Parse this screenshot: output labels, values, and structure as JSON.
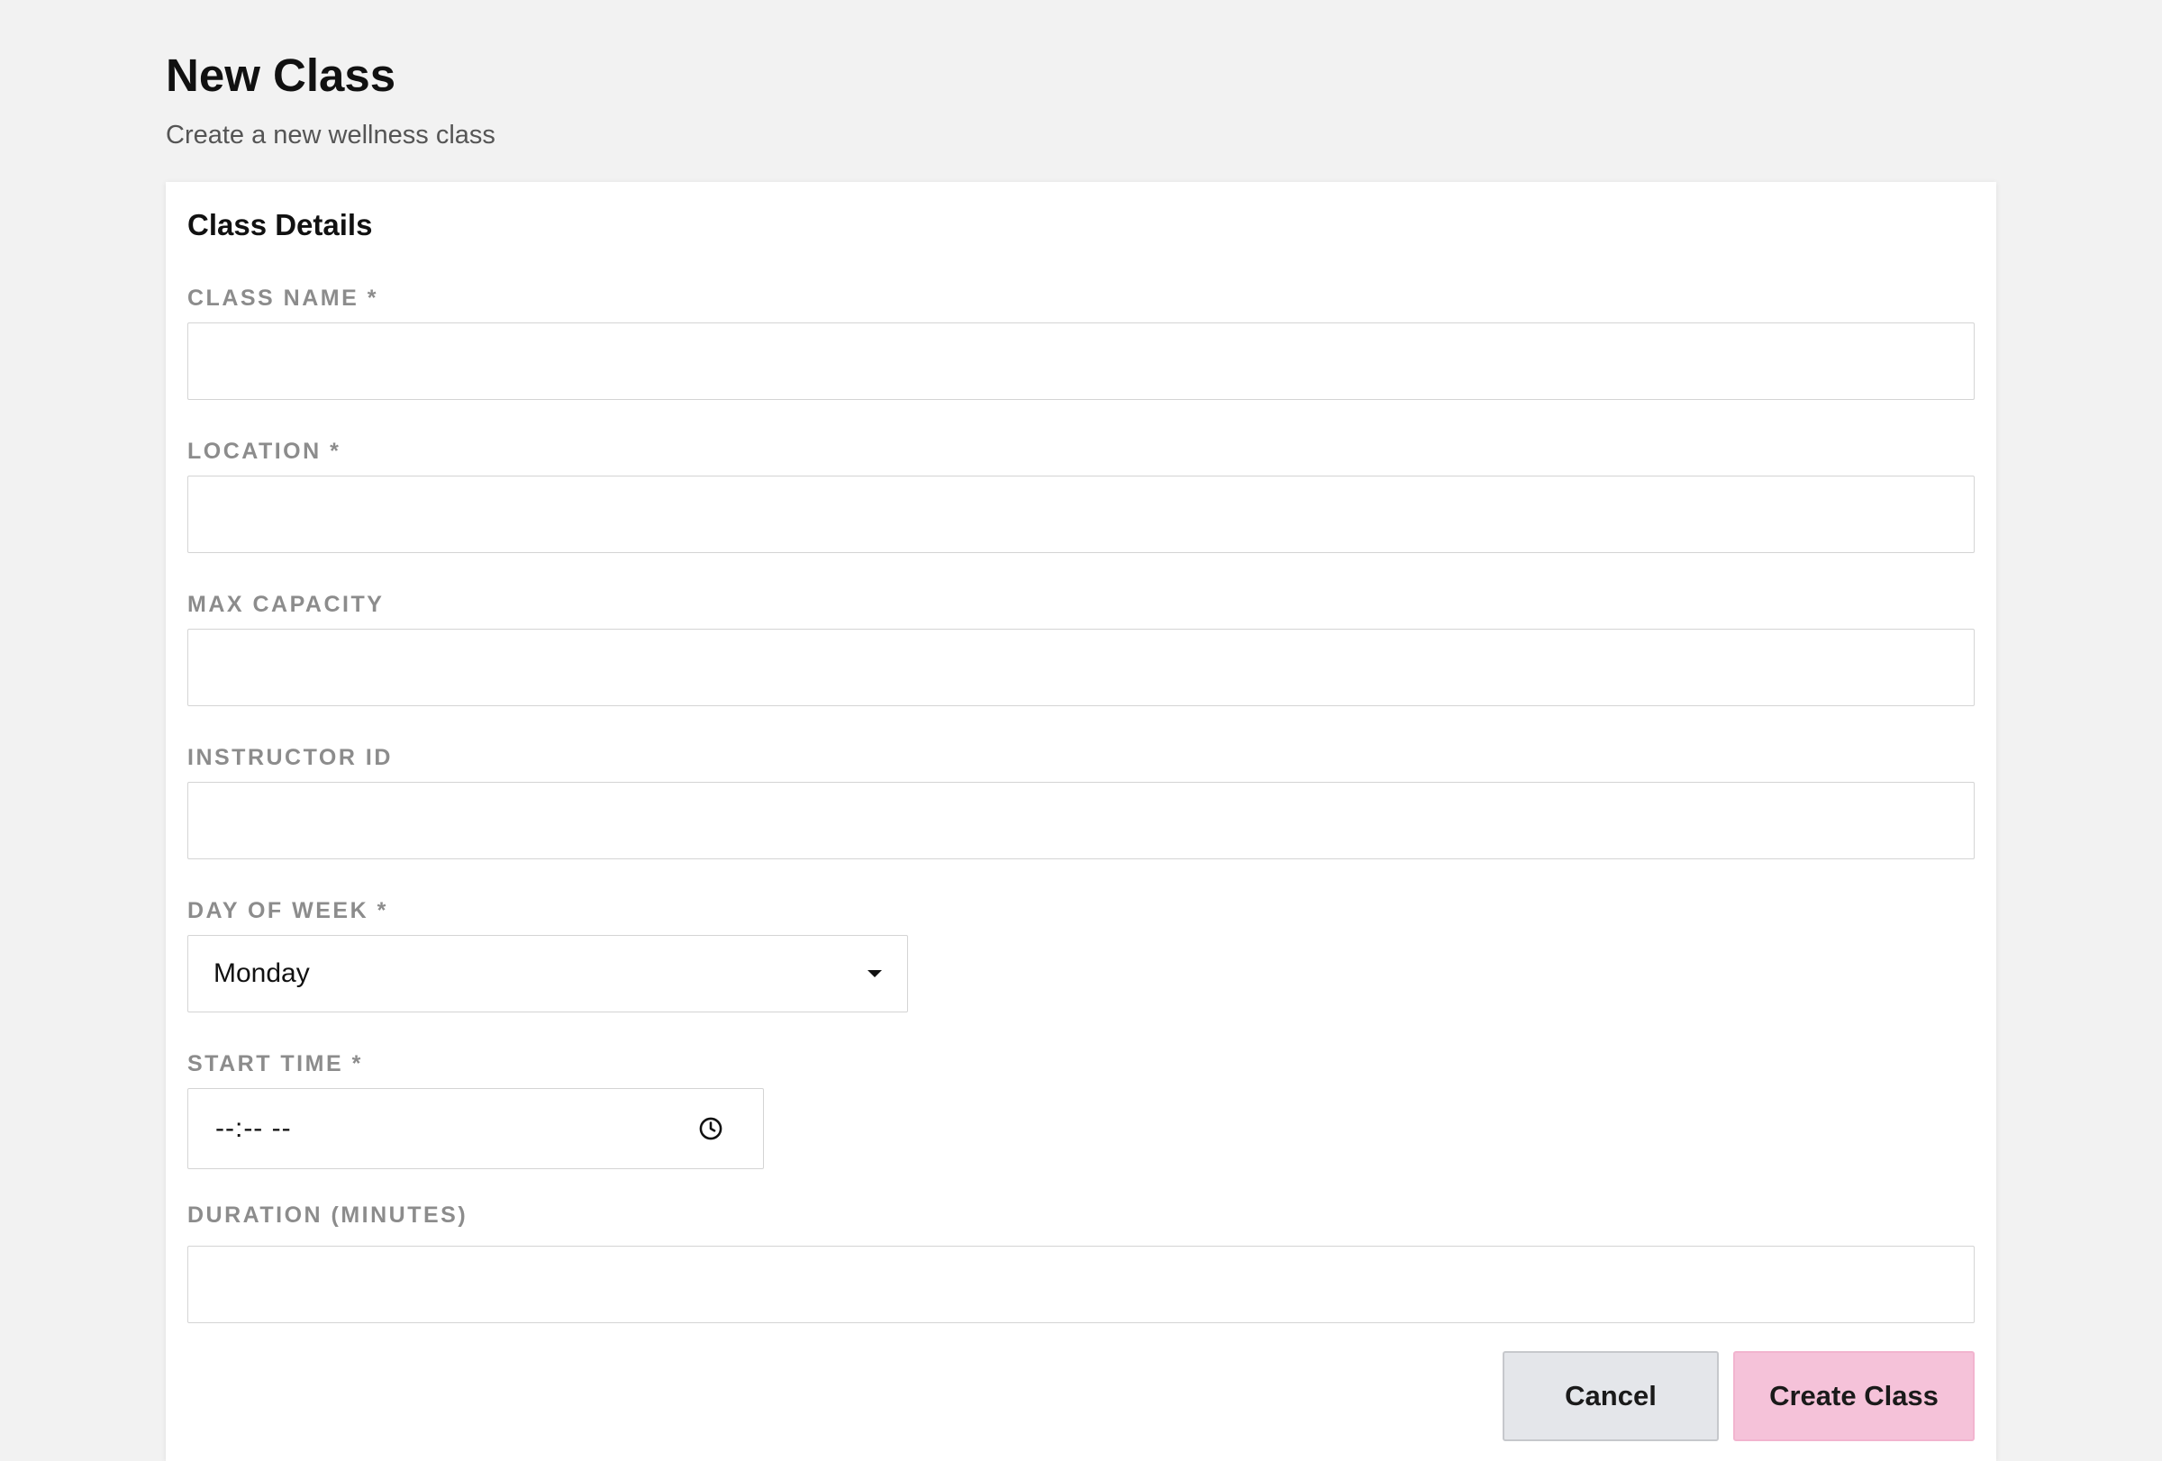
{
  "header": {
    "title": "New Class",
    "subtitle": "Create a new wellness class"
  },
  "form": {
    "section_title": "Class Details",
    "fields": {
      "class_name": {
        "label": "CLASS NAME *",
        "value": "",
        "placeholder": ""
      },
      "location": {
        "label": "LOCATION *",
        "value": "",
        "placeholder": ""
      },
      "max_capacity": {
        "label": "MAX CAPACITY",
        "value": "",
        "placeholder": ""
      },
      "instructor_id": {
        "label": "INSTRUCTOR ID",
        "value": "",
        "placeholder": ""
      },
      "day_of_week": {
        "label": "DAY OF WEEK *",
        "value": "Monday"
      },
      "start_time": {
        "label": "START TIME *",
        "value": "--:-- --"
      },
      "duration": {
        "label": "DURATION (MINUTES)",
        "value": "",
        "placeholder": ""
      }
    }
  },
  "actions": {
    "cancel_label": "Cancel",
    "create_label": "Create Class"
  },
  "icons": {
    "select_caret": "caret-down-icon",
    "time_picker": "clock-icon"
  },
  "colors": {
    "page_background": "#f2f2f2",
    "card_background": "#ffffff",
    "label_text": "#8c8c8c",
    "input_border": "#d4d4d4",
    "cancel_button": "#e4e6ea",
    "create_button": "#f5c2d9"
  }
}
